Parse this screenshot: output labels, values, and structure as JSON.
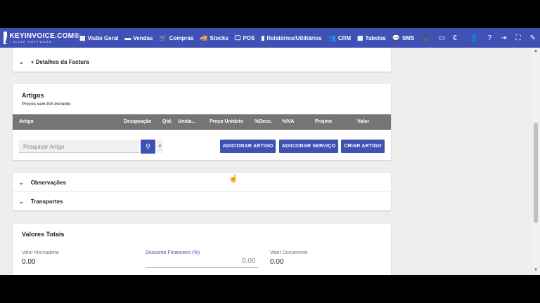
{
  "brand": {
    "name": "KEYINVOICE.COM®",
    "tagline": "ONLINE SOFTWARE"
  },
  "nav": [
    {
      "icon": "dashboard-icon",
      "glyph": "▦",
      "label": "Visão Geral"
    },
    {
      "icon": "sales-icon",
      "glyph": "▬",
      "label": "Vendas"
    },
    {
      "icon": "cart-icon",
      "glyph": "🛒",
      "label": "Compras"
    },
    {
      "icon": "truck-icon",
      "glyph": "🚚",
      "label": "Stocks"
    },
    {
      "icon": "monitor-icon",
      "glyph": "🖵",
      "label": "POS"
    },
    {
      "icon": "bar-chart-icon",
      "glyph": "▮",
      "label": "Relatórios/Utilitários"
    },
    {
      "icon": "people-icon",
      "glyph": "👥",
      "label": "CRM"
    },
    {
      "icon": "table-icon",
      "glyph": "▦",
      "label": "Tabelas"
    },
    {
      "icon": "chat-icon",
      "glyph": "💬",
      "label": "SMS"
    }
  ],
  "extra_icons": [
    {
      "icon": "headset-icon",
      "glyph": "🎧"
    },
    {
      "icon": "folder-icon",
      "glyph": "▭"
    },
    {
      "icon": "euro-icon",
      "glyph": "€"
    }
  ],
  "right_icons": [
    {
      "icon": "user-icon",
      "glyph": "👤"
    },
    {
      "icon": "help-icon",
      "glyph": "?"
    },
    {
      "icon": "logout-icon",
      "glyph": "⇥"
    },
    {
      "icon": "fullscreen-icon",
      "glyph": "⛶"
    },
    {
      "icon": "edit-icon",
      "glyph": "✎"
    }
  ],
  "invoice_details": {
    "label": "+ Detalhes da Factura"
  },
  "artigos": {
    "title": "Artigos",
    "subtitle": "Preços sem IVA incluído",
    "columns": [
      "Artigo",
      "Designação",
      "Qtd.",
      "Unida...",
      "Preço Unitário",
      "%Desc.",
      "%IVA",
      "Projeto",
      "Valor"
    ],
    "search_placeholder": "Pesquisar Artigo",
    "btn_add_item": "ADICIONAR ARTIGO",
    "btn_add_service": "ADICIONAR SERVIÇO",
    "btn_create_item": "CRIAR ARTIGO"
  },
  "sections": {
    "observacoes": "Observações",
    "transportes": "Transportes"
  },
  "totals": {
    "title": "Valores Totais",
    "merchandise_label": "Valor Mercadoria",
    "merchandise_value": "0.00",
    "discount_label": "Desconto Financeiro (%)",
    "discount_value": "0.00",
    "document_label": "Valor Documento",
    "document_value": "0.00"
  },
  "colors": {
    "primary": "#3f51b5",
    "table_header": "#757575",
    "background": "#eeeeee"
  }
}
